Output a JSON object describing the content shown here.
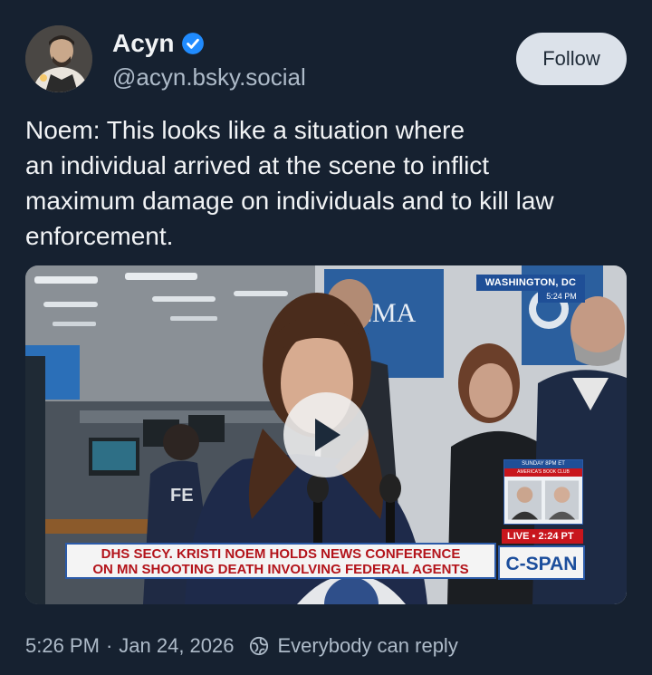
{
  "author": {
    "display_name": "Acyn",
    "handle": "@acyn.bsky.social",
    "verified": true,
    "verified_color": "#208bfe"
  },
  "follow_button": {
    "label": "Follow"
  },
  "post": {
    "text": "Noem: This looks like a situation where\nan individual arrived at the scene to inflict\nmaximum damage on individuals and to kill law\nenforcement."
  },
  "video": {
    "location_bug": "WASHINGTON, DC",
    "location_time": "5:24 PM",
    "backdrop_sign": "FEMA",
    "jacket_text": "FE",
    "chyron_line1": "DHS SECY. KRISTI NOEM HOLDS NEWS CONFERENCE",
    "chyron_line2": "ON MN SHOOTING DEATH INVOLVING FEDERAL AGENTS",
    "live_label": "LIVE ▪ 2:24 PT",
    "network": "C-SPAN",
    "promo_top": "SUNDAY 8PM ET",
    "promo_title": "AMERICA'S BOOK CLUB"
  },
  "footer": {
    "time": "5:26 PM",
    "separator": "·",
    "date": "Jan 24, 2026",
    "reply_setting": "Everybody can reply"
  },
  "colors": {
    "background": "#162130",
    "text": "#f1f3f5",
    "secondary_text": "#aebbc9",
    "follow_button_bg": "#dce2ea",
    "chyron_red": "#b3141b",
    "cspan_blue": "#1c4e9c"
  }
}
